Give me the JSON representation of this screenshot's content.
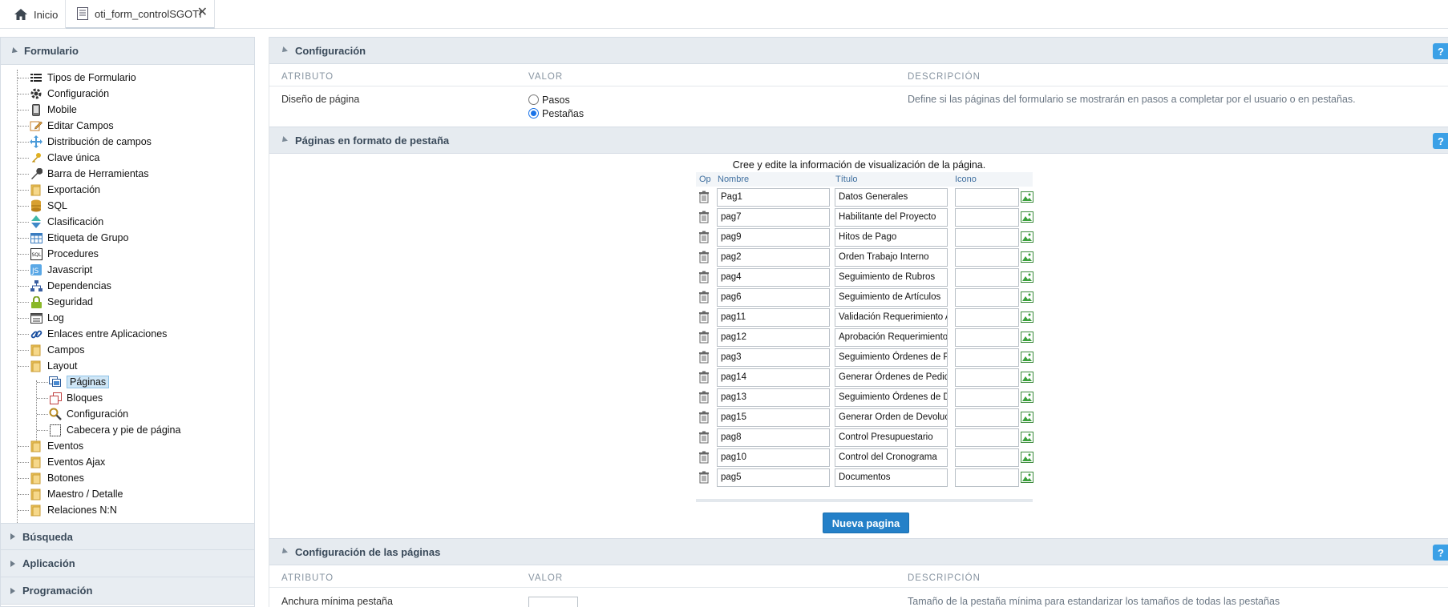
{
  "tabs": [
    {
      "label": "Inicio"
    },
    {
      "label": "oti_form_controlSGOTI"
    }
  ],
  "sidebar": {
    "title": "Formulario",
    "items": [
      {
        "label": "Tipos de Formulario",
        "icon": "list-icon"
      },
      {
        "label": "Configuración",
        "icon": "gear-icon"
      },
      {
        "label": "Mobile",
        "icon": "mobile-icon"
      },
      {
        "label": "Editar Campos",
        "icon": "edit-icon"
      },
      {
        "label": "Distribución de campos",
        "icon": "move-icon"
      },
      {
        "label": "Clave única",
        "icon": "key-icon"
      },
      {
        "label": "Barra de Herramientas",
        "icon": "wrench-icon"
      },
      {
        "label": "Exportación",
        "icon": "folder-icon"
      },
      {
        "label": "SQL",
        "icon": "database-icon"
      },
      {
        "label": "Clasificación",
        "icon": "sort-icon"
      },
      {
        "label": "Etiqueta de Grupo",
        "icon": "table-icon"
      },
      {
        "label": "Procedures",
        "icon": "sql-icon"
      },
      {
        "label": "Javascript",
        "icon": "js-icon"
      },
      {
        "label": "Dependencias",
        "icon": "hierarchy-icon"
      },
      {
        "label": "Seguridad",
        "icon": "lock-icon"
      },
      {
        "label": "Log",
        "icon": "log-icon"
      },
      {
        "label": "Enlaces entre Aplicaciones",
        "icon": "link-icon"
      },
      {
        "label": "Campos",
        "icon": "folder-icon"
      },
      {
        "label": "Layout",
        "icon": "folder-icon"
      },
      {
        "label": "Eventos",
        "icon": "folder-icon"
      },
      {
        "label": "Eventos Ajax",
        "icon": "folder-icon"
      },
      {
        "label": "Botones",
        "icon": "folder-icon"
      },
      {
        "label": "Maestro / Detalle",
        "icon": "folder-icon"
      },
      {
        "label": "Relaciones N:N",
        "icon": "folder-icon"
      }
    ],
    "layout_children": [
      {
        "label": "Páginas",
        "icon": "pages-icon",
        "selected": true
      },
      {
        "label": "Bloques",
        "icon": "blocks-icon"
      },
      {
        "label": "Configuración",
        "icon": "magnifier-icon"
      },
      {
        "label": "Cabecera y pie de página",
        "icon": "header-footer-icon"
      }
    ],
    "collapsed_sections": [
      "Búsqueda",
      "Aplicación",
      "Programación"
    ]
  },
  "config_section": {
    "title": "Configuración",
    "col_attr": "ATRIBUTO",
    "col_value": "VALOR",
    "col_desc": "DESCRIPCIÓN",
    "row_label": "Diseño de página",
    "options": [
      {
        "label": "Pasos",
        "checked": false
      },
      {
        "label": "Pestañas",
        "checked": true
      }
    ],
    "row_desc": "Define si las páginas del formulario se mostrarán en pasos a completar por el usuario o en pestañas."
  },
  "pages_section": {
    "title": "Páginas en formato de pestaña",
    "caption": "Cree y edite la información de visualización de la página.",
    "headers": {
      "op": "Op",
      "nombre": "Nombre",
      "titulo": "Título",
      "icono": "Icono"
    },
    "rows": [
      {
        "nombre": "Pag1",
        "titulo": "Datos Generales",
        "icono": ""
      },
      {
        "nombre": "pag7",
        "titulo": "Habilitante del Proyecto",
        "icono": ""
      },
      {
        "nombre": "pag9",
        "titulo": "Hitos de Pago",
        "icono": ""
      },
      {
        "nombre": "pag2",
        "titulo": "Orden Trabajo Interno",
        "icono": ""
      },
      {
        "nombre": "pag4",
        "titulo": "Seguimiento de Rubros",
        "icono": ""
      },
      {
        "nombre": "pag6",
        "titulo": "Seguimiento de Artículos",
        "icono": ""
      },
      {
        "nombre": "pag11",
        "titulo": "Validación Requerimiento A",
        "icono": ""
      },
      {
        "nombre": "pag12",
        "titulo": "Aprobación Requerimiento",
        "icono": ""
      },
      {
        "nombre": "pag3",
        "titulo": "Seguimiento Órdenes de P",
        "icono": ""
      },
      {
        "nombre": "pag14",
        "titulo": "Generar Órdenes de Pedid",
        "icono": ""
      },
      {
        "nombre": "pag13",
        "titulo": "Seguimiento Órdenes de D",
        "icono": ""
      },
      {
        "nombre": "pag15",
        "titulo": "Generar Orden de Devoluc",
        "icono": ""
      },
      {
        "nombre": "pag8",
        "titulo": "Control Presupuestario",
        "icono": ""
      },
      {
        "nombre": "pag10",
        "titulo": "Control del Cronograma",
        "icono": ""
      },
      {
        "nombre": "pag5",
        "titulo": "Documentos",
        "icono": ""
      }
    ],
    "new_button": "Nueva pagina"
  },
  "page_config_section": {
    "title": "Configuración de las páginas",
    "col_attr": "ATRIBUTO",
    "col_value": "VALOR",
    "col_desc": "DESCRIPCIÓN",
    "row_label": "Anchura mínima pestaña",
    "row_value": "",
    "row_desc": "Tamaño de la pestaña mínima para estandarizar los tamaños de todas las pestañas"
  },
  "help_label": "?",
  "colors": {
    "accent": "#2480c8",
    "help": "#3ba0e6",
    "header_bg": "#e6ebf0"
  }
}
